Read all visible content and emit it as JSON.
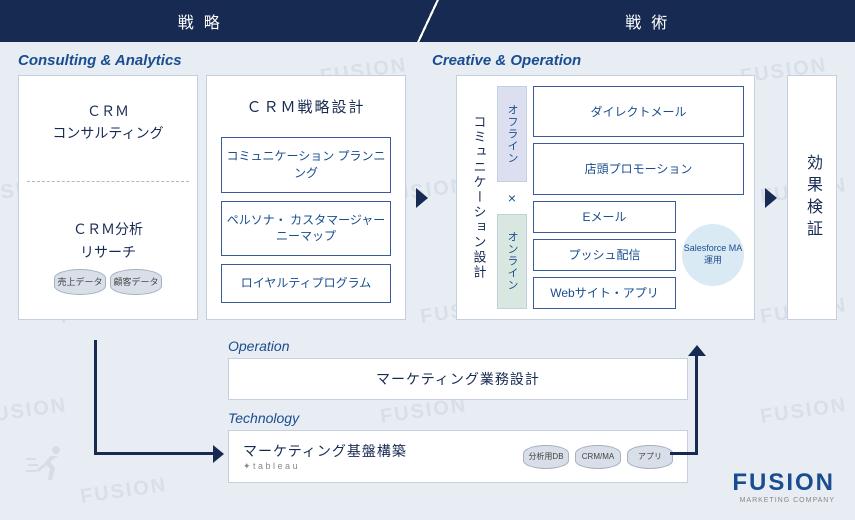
{
  "header": {
    "left": "戦略",
    "right": "戦術"
  },
  "sections": {
    "consulting": "Consulting & Analytics",
    "creative": "Creative & Operation",
    "operation": "Operation",
    "technology": "Technology"
  },
  "consulting": {
    "top_line1": "ＣＲＭ",
    "top_line2": "コンサルティング",
    "bottom_line1": "ＣＲＭ分析",
    "bottom_line2": "リサーチ",
    "cyl1": "売上データ",
    "cyl2": "顧客データ"
  },
  "strategy": {
    "title": "ＣＲＭ戦略設計",
    "items": [
      "コミュニケーション\nプランニング",
      "ペルソナ・\nカスタマージャーニーマップ",
      "ロイヤルティプログラム"
    ]
  },
  "creative": {
    "comm_design": "コミュニケーション設計",
    "offline": "オフライン",
    "online": "オンライン",
    "cross": "×",
    "offline_channels": [
      "ダイレクトメール",
      "店頭プロモーション"
    ],
    "online_channels": [
      "Eメール",
      "プッシュ配信",
      "Webサイト・アプリ"
    ],
    "salesforce": "Salesforce\nMA運用"
  },
  "verify": "効果検証",
  "operation": {
    "title": "マーケティング業務設計"
  },
  "technology": {
    "title": "マーケティング基盤構築",
    "tableau": "✦ t a b l e a u",
    "cyls": [
      "分析用DB",
      "CRM/MA",
      "アプリ"
    ]
  },
  "logo": {
    "main": "FUSION",
    "sub": "MARKETING COMPANY"
  },
  "watermark": "FUSION"
}
